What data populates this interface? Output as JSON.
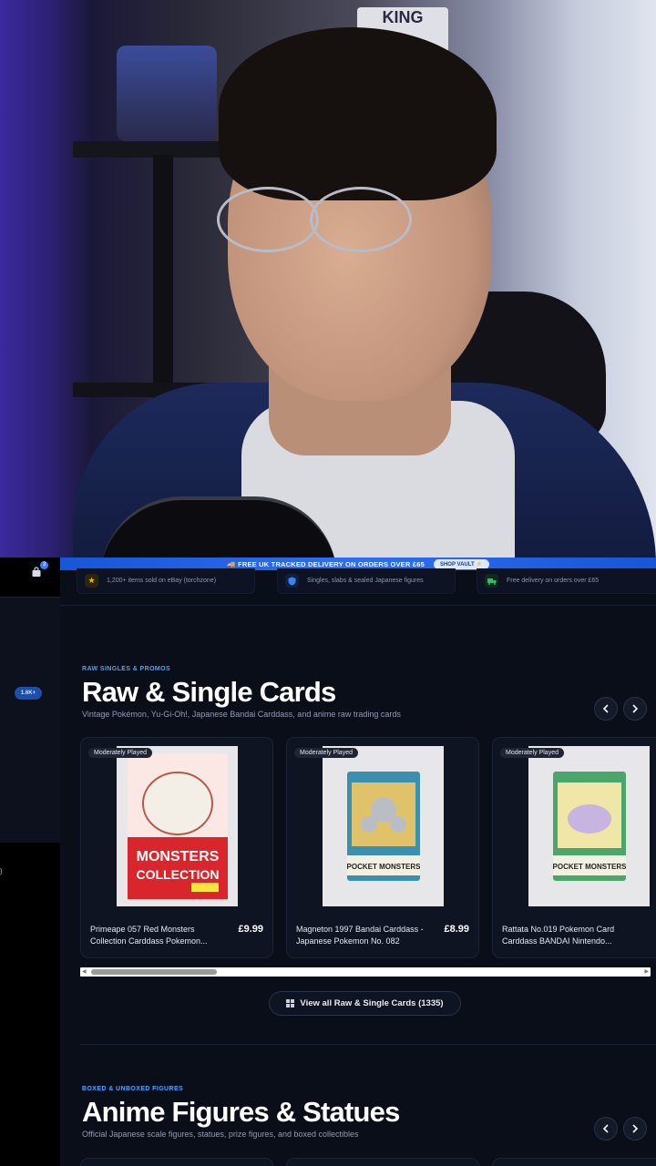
{
  "header": {
    "promo_text": "🚚 FREE UK TRACKED DELIVERY ON ORDERS OVER £65",
    "promo_button": "SHOP VAULT ⚡"
  },
  "sidebar": {
    "cart_count": "3",
    "sold_badge": "1.6K+",
    "stray_text": ")"
  },
  "trust_strip": [
    {
      "icon": "star-icon",
      "color": "#f5b400",
      "text": "1,200+ items sold on eBay (torchzone)"
    },
    {
      "icon": "shield-icon",
      "color": "#3b82f6",
      "text": "Singles, slabs & sealed Japanese figures"
    },
    {
      "icon": "truck-icon",
      "color": "#22c55e",
      "text": "Free delivery on orders over £65"
    }
  ],
  "raw_section": {
    "eyebrow": "RAW SINGLES & PROMOS",
    "title": "Raw & Single Cards",
    "subtitle": "Vintage Pokémon, Yu-Gi-Oh!, Japanese Bandai Carddass, and anime raw trading cards",
    "products": [
      {
        "condition": "Moderately Played",
        "name": "Primeape 057 Red Monsters Collection Carddass Pokemon...",
        "price": "£9.99",
        "card_text": "MONSTERS COLLECTION"
      },
      {
        "condition": "Moderately Played",
        "name": "Magneton 1997 Bandai Carddass - Japanese Pokemon No. 082",
        "price": "£8.99",
        "card_text": "POCKET MONSTERS"
      },
      {
        "condition": "Moderately Played",
        "name": "Rattata No.019 Pokemon Card Carddass BANDAI Nintendo...",
        "price": "",
        "card_text": "POCKET MONSTERS"
      }
    ],
    "view_all": "View all Raw & Single Cards (1335)"
  },
  "figures_section": {
    "eyebrow": "BOXED & UNBOXED FIGURES",
    "title": "Anime Figures & Statues",
    "subtitle": "Official Japanese scale figures, statues, prize figures, and boxed collectibles"
  },
  "webcam": {
    "sign_text": "KING"
  },
  "colors": {
    "accent": "#3b82f6",
    "background": "#0a0e18",
    "card": "#0e1422"
  }
}
